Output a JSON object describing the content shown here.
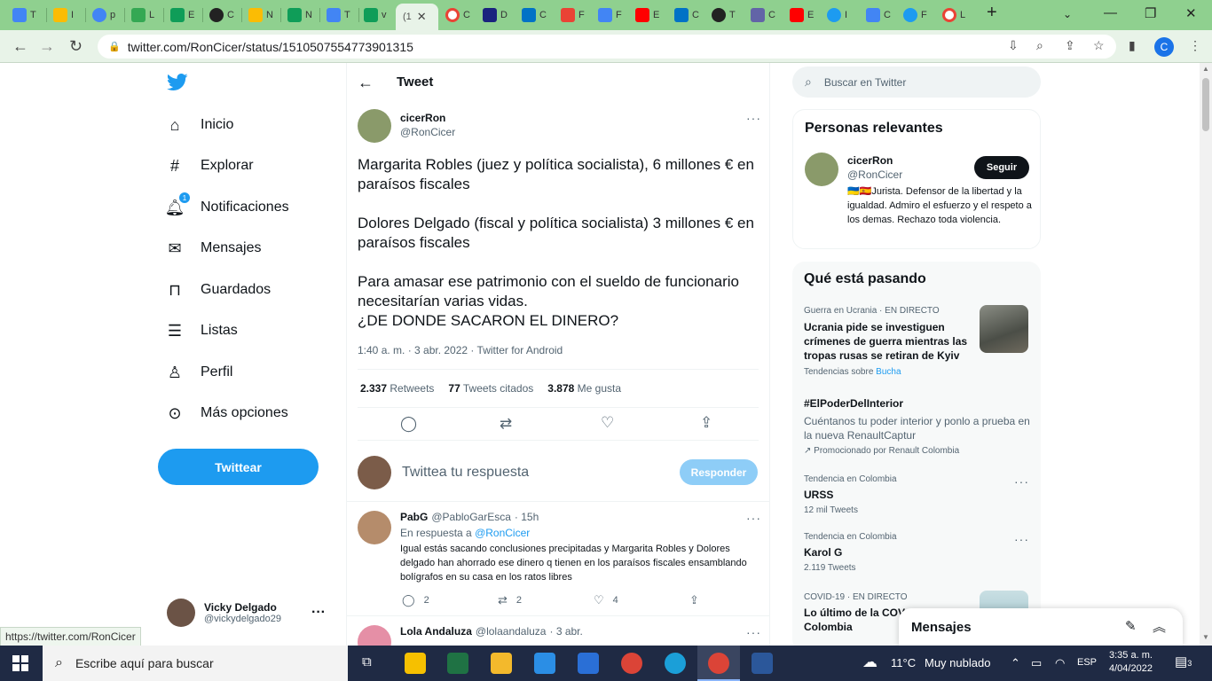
{
  "browser": {
    "tabs": [
      {
        "label": "T",
        "color": "#4285f4"
      },
      {
        "label": "I",
        "color": "#fbbc04"
      },
      {
        "label": "p",
        "color": "#4285f4"
      },
      {
        "label": "L",
        "color": "#34a853"
      },
      {
        "label": "E",
        "color": "#0f9d58"
      },
      {
        "label": "C",
        "color": "#222222"
      },
      {
        "label": "N",
        "color": "#fbbc04"
      },
      {
        "label": "N",
        "color": "#0f9d58"
      },
      {
        "label": "T",
        "color": "#4285f4"
      },
      {
        "label": "v",
        "color": "#0f9d58"
      }
    ],
    "active_tab_label": "(1",
    "more_tabs": [
      {
        "label": "C",
        "color": "#ea4335"
      },
      {
        "label": "D",
        "color": "#1a237e"
      },
      {
        "label": "C",
        "color": "#0072c6"
      },
      {
        "label": "F",
        "color": "#ea4335"
      },
      {
        "label": "F",
        "color": "#4285f4"
      },
      {
        "label": "E",
        "color": "#ff0000"
      },
      {
        "label": "C",
        "color": "#0072c6"
      },
      {
        "label": "T",
        "color": "#222222"
      },
      {
        "label": "C",
        "color": "#6264a7"
      },
      {
        "label": "E",
        "color": "#ff0000"
      },
      {
        "label": "I",
        "color": "#1d9bf0"
      },
      {
        "label": "C",
        "color": "#4285f4"
      },
      {
        "label": "F",
        "color": "#1d9bf0"
      },
      {
        "label": "L",
        "color": "#ea4335"
      }
    ],
    "url": "twitter.com/RonCicer/status/1510507554773901315",
    "profile_initial": "C"
  },
  "nav": {
    "items": [
      {
        "label": "Inicio",
        "icon": "home-icon"
      },
      {
        "label": "Explorar",
        "icon": "hashtag-icon"
      },
      {
        "label": "Notificaciones",
        "icon": "bell-icon",
        "badge": "1"
      },
      {
        "label": "Mensajes",
        "icon": "mail-icon"
      },
      {
        "label": "Guardados",
        "icon": "bookmark-icon"
      },
      {
        "label": "Listas",
        "icon": "list-icon"
      },
      {
        "label": "Perfil",
        "icon": "person-icon"
      },
      {
        "label": "Más opciones",
        "icon": "more-circle-icon"
      }
    ],
    "tweet_button": "Twittear",
    "account_name": "Vicky Delgado",
    "account_handle": "@vickydelgado29",
    "status_url": "https://twitter.com/RonCicer"
  },
  "main": {
    "header_title": "Tweet",
    "author_name": "cicerRon",
    "author_handle": "@RonCicer",
    "tweet_p1": "Margarita Robles (juez y política socialista), 6 millones € en paraísos fiscales",
    "tweet_p2": "Dolores Delgado (fiscal y política socialista) 3 millones € en paraísos fiscales",
    "tweet_p3a": "Para amasar ese patrimonio con el sueldo de funcionario necesitarían varias vidas.",
    "tweet_p3b": " ¿DE DONDE SACARON EL DINERO?",
    "meta": "1:40 a. m. · 3 abr. 2022 · Twitter for Android",
    "stats": {
      "retweets_count": "2.337",
      "retweets_label": "Retweets",
      "quotes_count": "77",
      "quotes_label": "Tweets citados",
      "likes_count": "3.878",
      "likes_label": "Me gusta"
    },
    "reply_placeholder": "Twittea tu respuesta",
    "reply_button": "Responder",
    "replies": [
      {
        "name": "PabG",
        "handle": "@PabloGarEsca",
        "time": "· 15h",
        "replying_prefix": "En respuesta a",
        "replying_to": "@RonCicer",
        "text": "Igual estás sacando conclusiones precipitadas y Margarita Robles y Dolores delgado han ahorrado ese dinero q tienen en los paraísos fiscales ensamblando bolígrafos en su casa en los ratos libres",
        "reply_count": "2",
        "retweet_count": "2",
        "like_count": "4"
      },
      {
        "name": "Lola Andaluza",
        "handle": "@lolaandaluza",
        "time": "· 3 abr."
      }
    ]
  },
  "right": {
    "search_placeholder": "Buscar en Twitter",
    "relevant_title": "Personas relevantes",
    "relevant_name": "cicerRon",
    "relevant_handle": "@RonCicer",
    "follow_button": "Seguir",
    "bio": "🇺🇦🇪🇸Jurista. Defensor de la libertad y la igualdad. Admiro el esfuerzo y el respeto a los demas. Rechazo toda violencia.",
    "trends_title": "Qué está pasando",
    "trends": [
      {
        "meta": "Guerra en Ucrania · EN DIRECTO",
        "title": "Ucrania pide se investiguen crímenes de guerra mientras las tropas rusas se retiran de Kyiv",
        "sub_prefix": "Tendencias sobre",
        "sub_link": "Bucha"
      },
      {
        "title": "#ElPoderDelInterior",
        "desc": "Cuéntanos tu poder interior y ponlo a prueba en la nueva RenaultCaptur",
        "promo": "Promocionado por Renault Colombia"
      },
      {
        "meta": "Tendencia en Colombia",
        "title": "URSS",
        "sub": "12 mil Tweets"
      },
      {
        "meta": "Tendencia en Colombia",
        "title": "Karol G",
        "sub": "2.119 Tweets"
      },
      {
        "meta": "COVID-19 · EN DIRECTO",
        "title": "Lo último de la COV",
        "title2": "Colombia"
      }
    ],
    "messages_drawer": "Mensajes"
  },
  "taskbar": {
    "search_placeholder": "Escribe aquí para buscar",
    "temperature": "11°C",
    "weather": "Muy nublado",
    "language": "ESP",
    "time": "3:35 a. m.",
    "date": "4/04/2022",
    "notif_count": "3"
  }
}
